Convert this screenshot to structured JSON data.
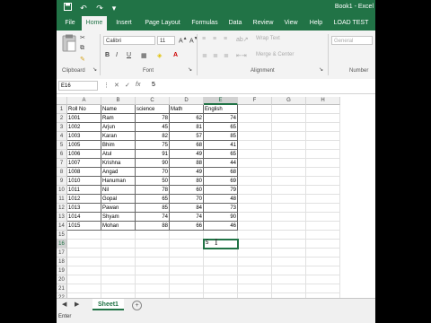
{
  "window": {
    "title": "Book1 - Excel"
  },
  "quick_access": {
    "save_icon": "save-icon",
    "undo_icon": "undo-icon",
    "redo_icon": "redo-icon"
  },
  "ribbon": {
    "tabs": [
      "File",
      "Home",
      "Insert",
      "Page Layout",
      "Formulas",
      "Data",
      "Review",
      "View",
      "Help",
      "LOAD TEST"
    ],
    "active_tab": "Home",
    "font_name": "Calibri",
    "font_size": "11",
    "bold": "B",
    "italic": "I",
    "underline": "U",
    "wrap_text": "Wrap Text",
    "merge_center": "Merge & Center",
    "number_format": "General",
    "groups": {
      "clipboard": "Clipboard",
      "font": "Font",
      "alignment": "Alignment",
      "number": "Number"
    }
  },
  "formula_bar": {
    "name_box": "E16",
    "fx": "fx",
    "value": "5"
  },
  "grid": {
    "columns": [
      "A",
      "B",
      "C",
      "D",
      "E",
      "F",
      "G",
      "H"
    ],
    "selected_column": "E",
    "selected_row": "16",
    "row_numbers": [
      "1",
      "2",
      "3",
      "4",
      "5",
      "6",
      "7",
      "8",
      "9",
      "10",
      "11",
      "12",
      "13",
      "14",
      "15",
      "16",
      "17",
      "18",
      "19",
      "20",
      "21",
      "22"
    ],
    "header": [
      "Roll No",
      "Name",
      "science",
      "Math",
      "English"
    ],
    "rows": [
      [
        "1001",
        "Ram",
        "78",
        "62",
        "74"
      ],
      [
        "1002",
        "Arjun",
        "45",
        "81",
        "65"
      ],
      [
        "1003",
        "Karan",
        "82",
        "57",
        "85"
      ],
      [
        "1005",
        "Bhim",
        "75",
        "68",
        "41"
      ],
      [
        "1006",
        "Atul",
        "91",
        "49",
        "65"
      ],
      [
        "1007",
        "Krishna",
        "90",
        "88",
        "44"
      ],
      [
        "1008",
        "Angad",
        "70",
        "49",
        "68"
      ],
      [
        "1010",
        "Hanuman",
        "50",
        "80",
        "69"
      ],
      [
        "1011",
        "Nil",
        "78",
        "60",
        "79"
      ],
      [
        "1012",
        "Gopal",
        "65",
        "70",
        "48"
      ],
      [
        "1013",
        "Pawan",
        "85",
        "84",
        "73"
      ],
      [
        "1014",
        "Shyam",
        "74",
        "74",
        "90"
      ],
      [
        "1015",
        "Mohan",
        "88",
        "66",
        "46"
      ]
    ],
    "active_cell_value": "5"
  },
  "sheets": {
    "active": "Sheet1",
    "add_icon": "plus-icon"
  },
  "status": {
    "mode": "Enter"
  }
}
